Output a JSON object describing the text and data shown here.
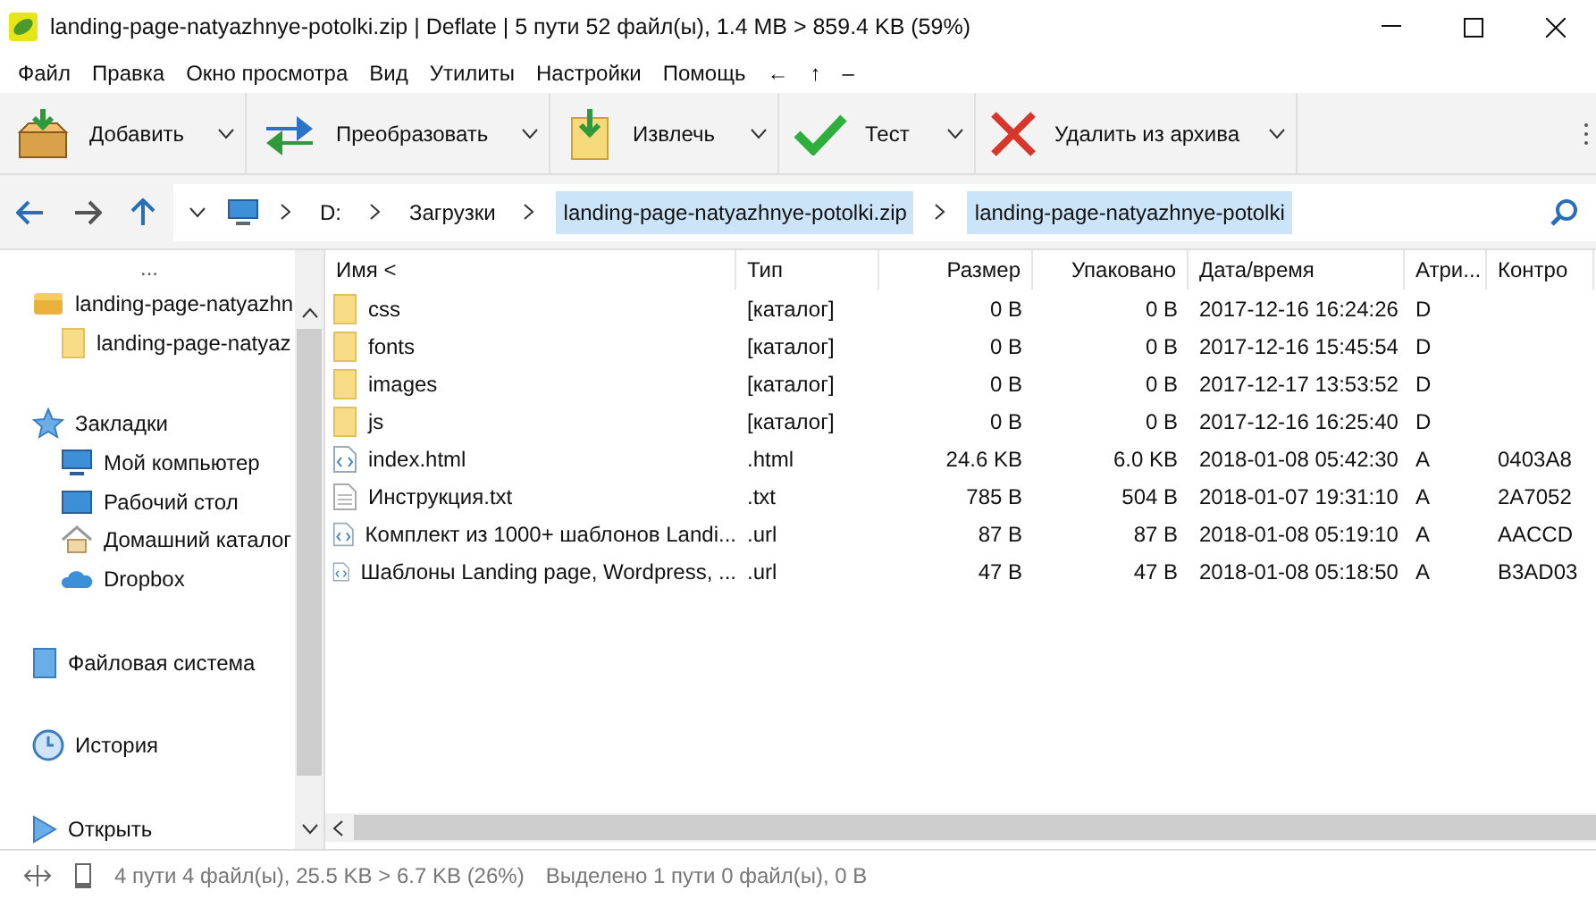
{
  "window": {
    "title": "landing-page-natyazhnye-potolki.zip | Deflate | 5 пути 52 файл(ы), 1.4 MB > 859.4 KB (59%)"
  },
  "menu": [
    {
      "label": "Файл"
    },
    {
      "label": "Правка"
    },
    {
      "label": "Окно просмотра"
    },
    {
      "label": "Вид"
    },
    {
      "label": "Утилиты"
    },
    {
      "label": "Настройки"
    },
    {
      "label": "Помощь"
    },
    {
      "label": "←"
    },
    {
      "label": "↑"
    },
    {
      "label": "–"
    }
  ],
  "toolbar": [
    {
      "kind": "add",
      "label": "Добавить"
    },
    {
      "kind": "convert",
      "label": "Преобразовать"
    },
    {
      "kind": "extract",
      "label": "Извлечь"
    },
    {
      "kind": "test",
      "label": "Тест"
    },
    {
      "kind": "delete",
      "label": "Удалить из архива"
    }
  ],
  "address": {
    "crumbs": [
      {
        "label": "D:",
        "selected": false
      },
      {
        "label": "Загрузки",
        "selected": false
      },
      {
        "label": "landing-page-natyazhnye-potolki.zip",
        "selected": true
      },
      {
        "label": "landing-page-natyazhnye-potolki",
        "selected": true
      }
    ]
  },
  "sidebar": {
    "more": "...",
    "sections": [
      {
        "kind": "archive",
        "label": "landing-page-natyazhn",
        "children": [
          {
            "kind": "folder",
            "label": "landing-page-natyaz"
          }
        ]
      },
      {
        "kind": "bookmarks",
        "label": "Закладки",
        "children": [
          {
            "kind": "computer",
            "label": "Мой компьютер"
          },
          {
            "kind": "desktop",
            "label": "Рабочий стол"
          },
          {
            "kind": "home",
            "label": "Домашний каталог"
          },
          {
            "kind": "cloud",
            "label": "Dropbox"
          }
        ]
      },
      {
        "kind": "filesystem",
        "label": "Файловая система"
      },
      {
        "kind": "history",
        "label": "История"
      },
      {
        "kind": "open",
        "label": "Открыть"
      }
    ]
  },
  "table": {
    "columns": [
      "Имя <",
      "Тип",
      "Размер",
      "Упаковано",
      "Дата/время",
      "Атри...",
      "Контро"
    ],
    "rows": [
      {
        "kind": "folder",
        "cells": [
          "css",
          "[каталог]",
          "0 B",
          "0 B",
          "2017-12-16 16:24:26",
          "D",
          ""
        ]
      },
      {
        "kind": "folder",
        "cells": [
          "fonts",
          "[каталог]",
          "0 B",
          "0 B",
          "2017-12-16 15:45:54",
          "D",
          ""
        ]
      },
      {
        "kind": "folder",
        "cells": [
          "images",
          "[каталог]",
          "0 B",
          "0 B",
          "2017-12-17 13:53:52",
          "D",
          ""
        ]
      },
      {
        "kind": "folder",
        "cells": [
          "js",
          "[каталог]",
          "0 B",
          "0 B",
          "2017-12-16 16:25:40",
          "D",
          ""
        ]
      },
      {
        "kind": "code",
        "cells": [
          "index.html",
          ".html",
          "24.6 KB",
          "6.0 KB",
          "2018-01-08 05:42:30",
          "A",
          "0403A8"
        ]
      },
      {
        "kind": "text",
        "cells": [
          "Инструкция.txt",
          ".txt",
          "785 B",
          "504 B",
          "2018-01-07 19:31:10",
          "A",
          "2A7052"
        ]
      },
      {
        "kind": "code",
        "cells": [
          "Комплект из 1000+ шаблонов Landi...",
          ".url",
          "87 B",
          "87 B",
          "2018-01-08 05:19:10",
          "A",
          "AACCD"
        ]
      },
      {
        "kind": "code",
        "cells": [
          "Шаблоны Landing page, Wordpress, ...",
          ".url",
          "47 B",
          "47 B",
          "2018-01-08 05:18:50",
          "A",
          "B3AD03"
        ]
      }
    ]
  },
  "status_bar": {
    "left": "4 пути 4 файл(ы), 25.5 KB > 6.7 KB (26%)",
    "right": "Выделено 1 пути 0 файл(ы), 0 B"
  }
}
